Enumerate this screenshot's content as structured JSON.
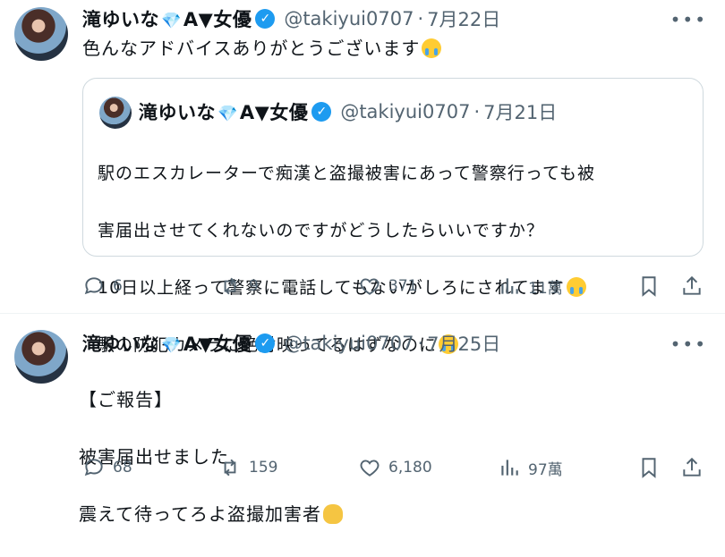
{
  "tweets": [
    {
      "author": {
        "name": "滝ゆいな",
        "gem": "💎",
        "tag": "A▼女優",
        "verified": "✓",
        "handle": "@takiyui0707"
      },
      "date": "7月22日",
      "text": "色んなアドバイスありがとうございます",
      "emoji": "loudly-crying-face",
      "more": "•••",
      "quote": {
        "author": {
          "name": "滝ゆいな",
          "gem": "💎",
          "tag": "A▼女優",
          "verified": "✓",
          "handle": "@takiyui0707"
        },
        "date": "7月21日",
        "lines": [
          "駅のエスカレーターで痴漢と盗撮被害にあって警察行っても被",
          "害届出させてくれないのですがどうしたらいいですか？",
          "10日以上経って警察に電話してもないがしろにされてます",
          "駅の防犯カメラに絶対映ってるはずなのに"
        ],
        "emoji": "loudly-crying-face"
      },
      "actions": {
        "replies": "6",
        "reposts": "9",
        "likes": "371",
        "views": "11萬"
      }
    },
    {
      "author": {
        "name": "滝ゆいな",
        "gem": "💎",
        "tag": "A▼女優",
        "verified": "✓",
        "handle": "@takiyui0707"
      },
      "date": "7月25日",
      "more": "•••",
      "lines": [
        "【ご報告】",
        "被害届出せました",
        "震えて待ってろよ盗撮加害者"
      ],
      "emoji": "oncoming-fist",
      "actions": {
        "replies": "68",
        "reposts": "159",
        "likes": "6,180",
        "views": "97萬"
      }
    }
  ],
  "icons": [
    "reply-icon",
    "repost-icon",
    "like-icon",
    "views-icon",
    "bookmark-icon",
    "share-icon",
    "verified-icon",
    "more-icon"
  ],
  "colors": {
    "verified": "#1d9bf0",
    "secondary": "#536471",
    "border": "#cfd9de"
  }
}
